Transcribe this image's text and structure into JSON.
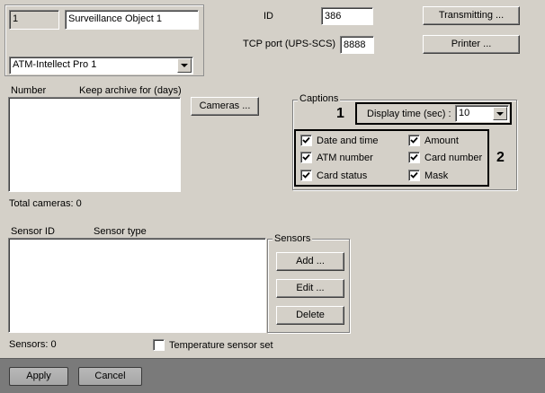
{
  "object": {
    "number": "1",
    "name": "Surveillance Object 1",
    "type": "ATM-Intellect Pro 1"
  },
  "id": {
    "label": "ID",
    "value": "386"
  },
  "tcp_port": {
    "label": "TCP port (UPS-SCS)",
    "value": "8888"
  },
  "buttons": {
    "transmitting": "Transmitting ...",
    "printer": "Printer ...",
    "cameras": "Cameras ...",
    "add": "Add ...",
    "edit": "Edit ...",
    "delete": "Delete",
    "apply": "Apply",
    "cancel": "Cancel"
  },
  "cameras_list": {
    "col_number": "Number",
    "col_archive": "Keep archive for (days)",
    "total": "Total cameras: 0"
  },
  "captions": {
    "title": "Captions",
    "display_time_label": "Display time (sec) :",
    "display_time_value": "10",
    "checkboxes": {
      "date_time": "Date and time",
      "amount": "Amount",
      "atm_number": "ATM number",
      "card_number": "Card number",
      "card_status": "Card status",
      "mask": "Mask"
    }
  },
  "annotations": {
    "one": "1",
    "two": "2"
  },
  "sensors_list": {
    "col_id": "Sensor ID",
    "col_type": "Sensor type",
    "group_title": "Sensors",
    "total": "Sensors: 0",
    "temperature_label": "Temperature sensor set"
  },
  "colors": {
    "dialog_bg": "#d4d0c8",
    "bottom_bar": "#7a7a7a"
  }
}
